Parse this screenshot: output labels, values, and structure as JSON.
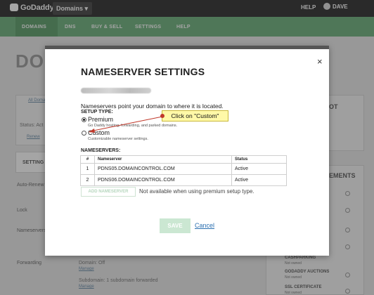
{
  "topbar": {
    "logo": "GoDaddy",
    "domains_menu": "Domains ▾",
    "help": "HELP",
    "user": "DAVE"
  },
  "nav": {
    "items": [
      "DOMAINS",
      "DNS",
      "BUY & SELL",
      "SETTINGS",
      "HELP"
    ]
  },
  "background": {
    "title": "DOM",
    "all_domains": "All Doma",
    "status": "Status: Act",
    "renew": "Renew",
    "settings_tab": "SETTING",
    "labels": [
      "Auto-Renew",
      "Lock",
      "Nameservers",
      "Forwarding"
    ],
    "forwarding_domain": "Domain: Off",
    "forwarding_subdomain": "Subdomain: 1 subdomain forwarded",
    "manage": "Manage",
    "right_heading": "OT",
    "right_heading2": "EMENTS",
    "right_items": [
      "CASHPARKING",
      "GODADDY AUCTIONS",
      "SSL CERTIFICATE"
    ],
    "not_owned": "Not owned",
    "add": "Add"
  },
  "modal": {
    "title": "NAMESERVER SETTINGS",
    "description": "Nameservers point your domain to where it is located.",
    "setup_type_label": "SETUP TYPE:",
    "options": [
      {
        "label": "Premium",
        "sub": "Go Daddy hosting, forwarding, and parked domains.",
        "selected": true
      },
      {
        "label": "Custom",
        "sub": "Customizable nameserver settings.",
        "selected": false
      }
    ],
    "callout": "Click on \"Custom\"",
    "nameservers_label": "NAMESERVERS:",
    "table": {
      "headers": [
        "#",
        "Nameserver",
        "Status"
      ],
      "rows": [
        [
          "1",
          "PDNS05.DOMAINCONTROL.COM",
          "Active"
        ],
        [
          "2",
          "PDNS06.DOMAINCONTROL.COM",
          "Active"
        ]
      ]
    },
    "add_button": "ADD NAMESERVER",
    "add_note": "Not available when using premium setup type.",
    "save": "SAVE",
    "cancel": "Cancel",
    "close": "×"
  },
  "colors": {
    "nav_green": "#6cb07a",
    "topbar_dark": "#2b2b2b",
    "callout_yellow": "#fff9a8",
    "link_blue": "#2a6fb0"
  }
}
